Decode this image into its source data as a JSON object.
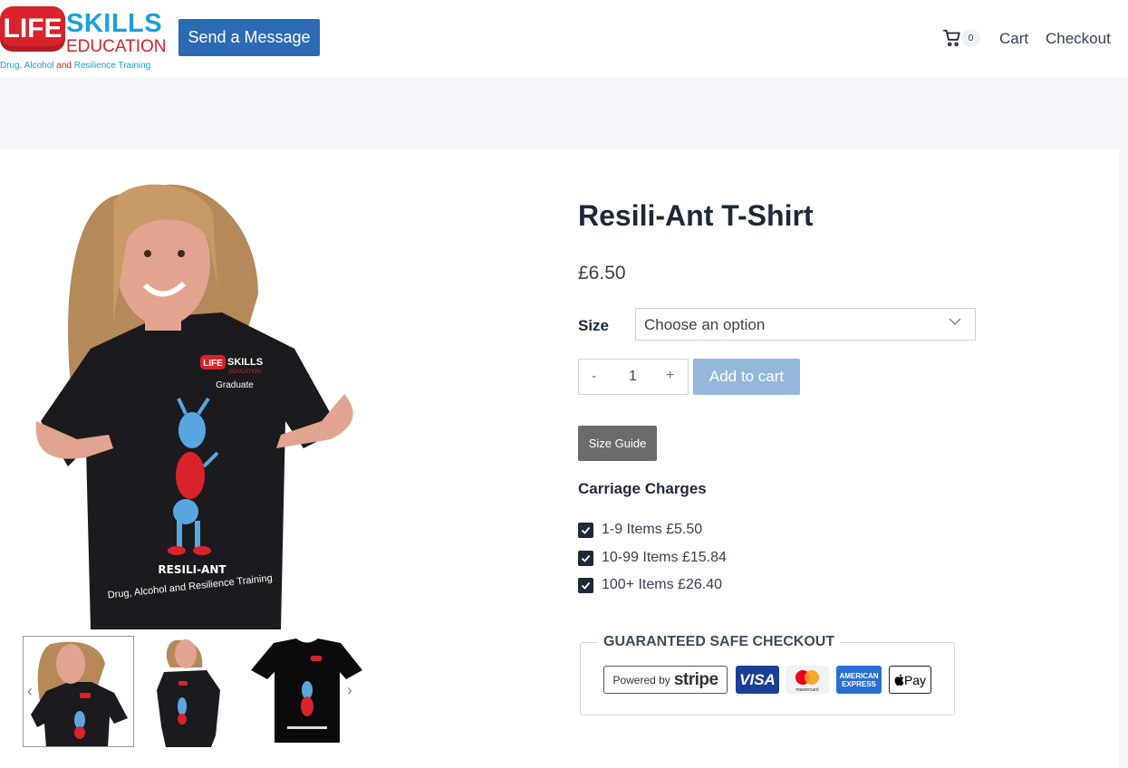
{
  "header": {
    "logo": {
      "life": "LIFE",
      "skills": "SKILLS",
      "education": "EDUCATION",
      "tagline_1": "Drug, Alcohol ",
      "tagline_and": "and",
      "tagline_2": " Resilience Training"
    },
    "send_message_label": "Send a Message",
    "cart_count": "0",
    "nav": {
      "cart": "Cart",
      "checkout": "Checkout"
    }
  },
  "product": {
    "title": "Resili-Ant T-Shirt",
    "price": "£6.50",
    "size_label": "Size",
    "size_select_value": "Choose an option",
    "quantity": {
      "minus": "-",
      "value": "1",
      "plus": "+"
    },
    "add_to_cart_label": "Add to cart",
    "size_guide_label": "Size Guide",
    "image_shirt_text": {
      "logo_life": "LIFE",
      "logo_skills": "SKILLS",
      "logo_education": "EDUCATION",
      "graduate": "Graduate",
      "mascot_name": "RESILI-ANT",
      "arc_text": "Drug, Alcohol and Resilience Training"
    }
  },
  "carriage": {
    "title": "Carriage Charges",
    "items": [
      "1-9 Items £5.50",
      "10-99 Items £15.84",
      "100+ Items £26.40"
    ]
  },
  "checkout_badge": {
    "legend": "GUARANTEED SAFE CHECKOUT",
    "stripe_prefix": "Powered by",
    "stripe_word": "stripe",
    "visa": "VISA",
    "mastercard": "mastercard",
    "amex_1": "AMERICAN",
    "amex_2": "EXPRESS",
    "applepay": "Pay"
  },
  "colors": {
    "accent": "#2a6bb3",
    "add_to_cart": "#96b7dc",
    "size_guide": "#6b6b6b",
    "brand_red": "#d8232a",
    "brand_blue": "#1ba0dc"
  },
  "icons": [
    "cart-icon",
    "chevron-down-icon",
    "checkbox-checked-icon",
    "chevron-left-icon",
    "chevron-right-icon",
    "apple-icon"
  ]
}
